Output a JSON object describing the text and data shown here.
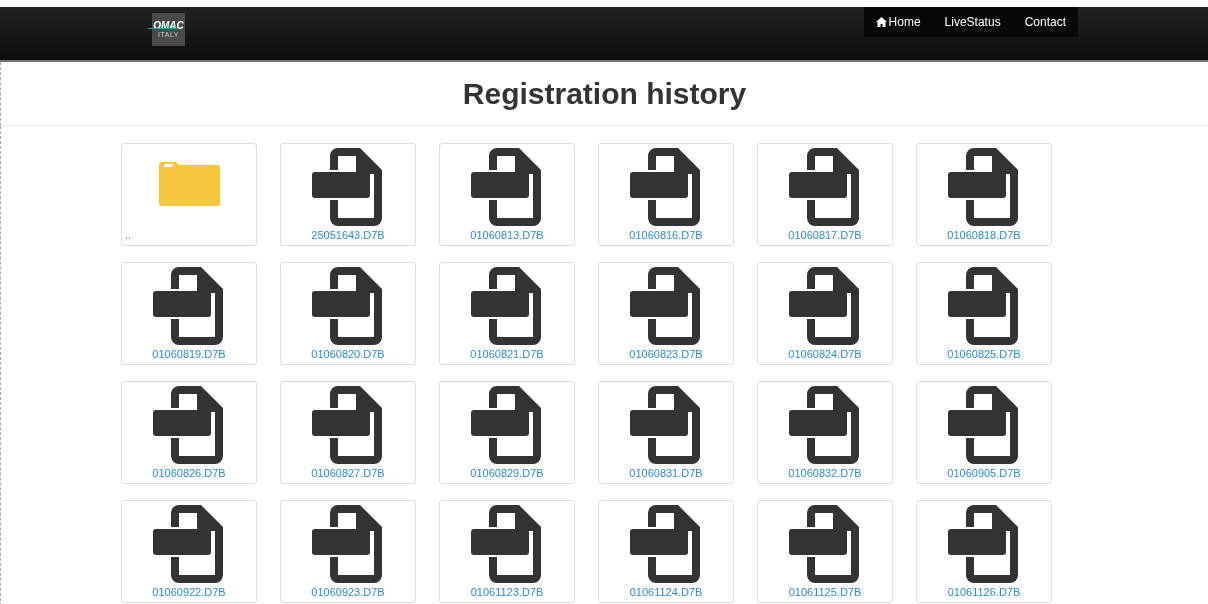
{
  "navbar": {
    "logo": {
      "name": "OMAC",
      "tagline": "ITALY"
    },
    "items": [
      {
        "label": "Home",
        "kind": "home"
      },
      {
        "label": "LiveStatus",
        "kind": "link"
      },
      {
        "label": "Contact",
        "kind": "link"
      }
    ]
  },
  "title": "Registration history",
  "files": [
    {
      "kind": "folder",
      "name": ".."
    },
    {
      "kind": "file",
      "name": "25051643.D7B"
    },
    {
      "kind": "file",
      "name": "01060813.D7B"
    },
    {
      "kind": "file",
      "name": "01060816.D7B"
    },
    {
      "kind": "file",
      "name": "01060817.D7B"
    },
    {
      "kind": "file",
      "name": "01060818.D7B"
    },
    {
      "kind": "file",
      "name": "01060819.D7B"
    },
    {
      "kind": "file",
      "name": "01060820.D7B"
    },
    {
      "kind": "file",
      "name": "01060821.D7B"
    },
    {
      "kind": "file",
      "name": "01060823.D7B"
    },
    {
      "kind": "file",
      "name": "01060824.D7B"
    },
    {
      "kind": "file",
      "name": "01060825.D7B"
    },
    {
      "kind": "file",
      "name": "01060826.D7B"
    },
    {
      "kind": "file",
      "name": "01060827.D7B"
    },
    {
      "kind": "file",
      "name": "01060829.D7B"
    },
    {
      "kind": "file",
      "name": "01060831.D7B"
    },
    {
      "kind": "file",
      "name": "01060832.D7B"
    },
    {
      "kind": "file",
      "name": "01060905.D7B"
    },
    {
      "kind": "file",
      "name": "01060922.D7B"
    },
    {
      "kind": "file",
      "name": "01060923.D7B"
    },
    {
      "kind": "file",
      "name": "01061123.D7B"
    },
    {
      "kind": "file",
      "name": "01061124.D7B"
    },
    {
      "kind": "file",
      "name": "01061125.D7B"
    },
    {
      "kind": "file",
      "name": "01061126.D7B"
    }
  ]
}
